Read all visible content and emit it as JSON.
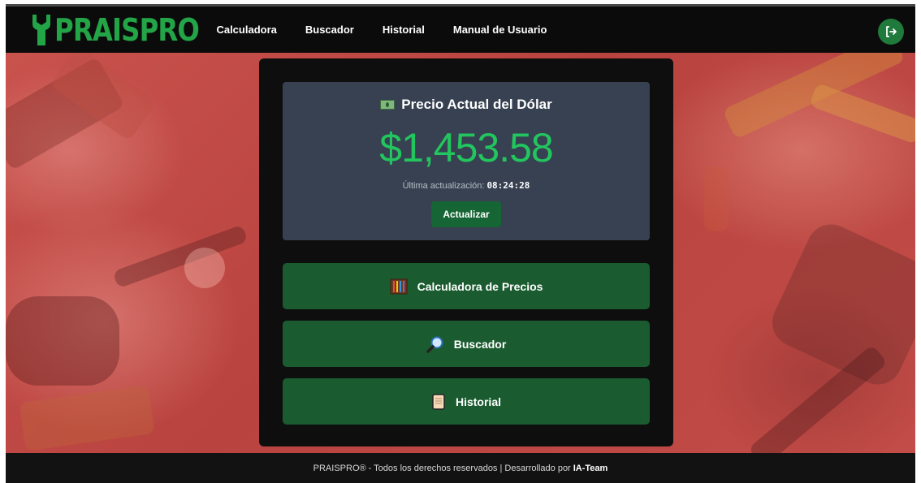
{
  "app": {
    "logo_text": "PRAISPRO"
  },
  "nav": {
    "items": [
      "Calculadora",
      "Buscador",
      "Historial",
      "Manual de Usuario"
    ]
  },
  "dollar_card": {
    "title": "Precio Actual del Dólar",
    "price": "$1,453.58",
    "updated_label": "Última actualización:",
    "updated_time": "08:24:28",
    "refresh_label": "Actualizar"
  },
  "actions": [
    {
      "label": "Calculadora de Precios",
      "icon": "abacus-icon"
    },
    {
      "label": "Buscador",
      "icon": "magnifier-icon"
    },
    {
      "label": "Historial",
      "icon": "scroll-icon"
    }
  ],
  "footer": {
    "text": "PRAISPRO® - Todos los derechos reservados | Desarrollado por",
    "team": "IA-Team"
  },
  "colors": {
    "brand_green": "#22a447",
    "price_green": "#22c55e",
    "button_green": "#1a5c30",
    "background_red": "#c24c47"
  }
}
